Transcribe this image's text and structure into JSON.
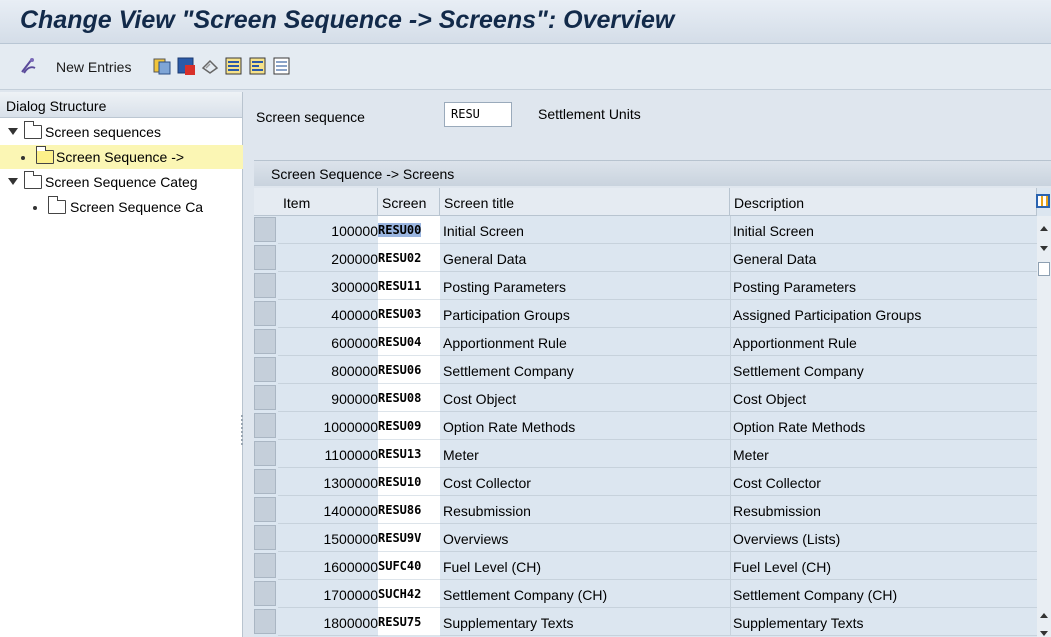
{
  "window": {
    "title": "Change View \"Screen Sequence -> Screens\": Overview"
  },
  "toolbar": {
    "new_entries_label": "New Entries",
    "icons": [
      "display-change-icon",
      "copy-icon",
      "delete-icon",
      "undo-icon",
      "select-all-icon",
      "select-block-icon",
      "deselect-all-icon"
    ]
  },
  "dialog_structure": {
    "header": "Dialog Structure",
    "items": [
      {
        "label": "Screen sequences",
        "level": 0,
        "expanded": true,
        "selected": false
      },
      {
        "label": "Screen Sequence ->",
        "level": 1,
        "expanded": false,
        "selected": true
      },
      {
        "label": "Screen Sequence Categ",
        "level": 0,
        "expanded": true,
        "selected": false
      },
      {
        "label": "Screen Sequence Ca",
        "level": 1,
        "expanded": false,
        "selected": false
      }
    ]
  },
  "header_fields": {
    "screen_sequence_label": "Screen sequence",
    "screen_sequence_value": "RESU",
    "screen_sequence_desc": "Settlement Units"
  },
  "table": {
    "title": "Screen Sequence -> Screens",
    "columns": {
      "item": "Item",
      "screen": "Screen",
      "title": "Screen title",
      "description": "Description"
    },
    "rows": [
      {
        "item": "100000",
        "screen": "RESU00",
        "title": "Initial Screen",
        "description": "Initial Screen",
        "highlight": true
      },
      {
        "item": "200000",
        "screen": "RESU02",
        "title": "General Data",
        "description": "General Data"
      },
      {
        "item": "300000",
        "screen": "RESU11",
        "title": "Posting Parameters",
        "description": "Posting Parameters"
      },
      {
        "item": "400000",
        "screen": "RESU03",
        "title": "Participation Groups",
        "description": "Assigned Participation Groups"
      },
      {
        "item": "600000",
        "screen": "RESU04",
        "title": "Apportionment Rule",
        "description": "Apportionment Rule"
      },
      {
        "item": "800000",
        "screen": "RESU06",
        "title": "Settlement Company",
        "description": "Settlement Company"
      },
      {
        "item": "900000",
        "screen": "RESU08",
        "title": "Cost Object",
        "description": "Cost Object"
      },
      {
        "item": "1000000",
        "screen": "RESU09",
        "title": "Option Rate Methods",
        "description": "Option Rate Methods"
      },
      {
        "item": "1100000",
        "screen": "RESU13",
        "title": "Meter",
        "description": "Meter"
      },
      {
        "item": "1300000",
        "screen": "RESU10",
        "title": "Cost Collector",
        "description": "Cost Collector"
      },
      {
        "item": "1400000",
        "screen": "RESU86",
        "title": "Resubmission",
        "description": "Resubmission"
      },
      {
        "item": "1500000",
        "screen": "RESU9V",
        "title": "Overviews",
        "description": "Overviews (Lists)"
      },
      {
        "item": "1600000",
        "screen": "SUFC40",
        "title": "Fuel Level (CH)",
        "description": "Fuel Level (CH)"
      },
      {
        "item": "1700000",
        "screen": "SUCH42",
        "title": "Settlement Company (CH)",
        "description": "Settlement Company (CH)"
      },
      {
        "item": "1800000",
        "screen": "RESU75",
        "title": "Supplementary Texts",
        "description": "Supplementary Texts"
      }
    ]
  },
  "colors": {
    "title": "#122a4a",
    "selection": "#fbf6b4",
    "highlight": "#9ab5e0",
    "background": "#dfe6ee"
  }
}
